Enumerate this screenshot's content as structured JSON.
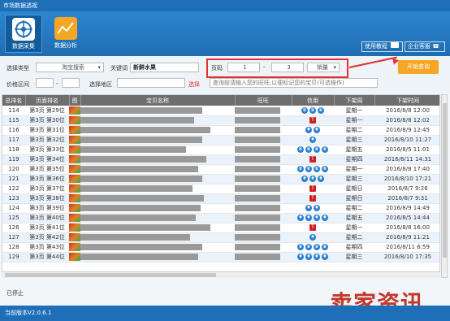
{
  "window": {
    "title": "市场数据透视"
  },
  "toolbar": {
    "tools": [
      {
        "label": "数据采集",
        "icon": "target-icon",
        "active": true
      },
      {
        "label": "数据分析",
        "icon": "chart-icon",
        "active": false
      }
    ],
    "tutorial_label": "使用教程",
    "support_label": "企业客服"
  },
  "filters": {
    "select_type_label": "选择类型",
    "select_type_value": "淘宝搜索",
    "keyword_label": "关键词",
    "keyword_value": "新鲜水果",
    "page_label": "页码",
    "page_from": "1",
    "page_sep": "-",
    "page_to": "3",
    "sort_value": "销量",
    "price_label": "价格区间",
    "price_sep": "-",
    "region_label": "选择地区",
    "region_action": "选择",
    "shop_placeholder": "查询前请输入您的旺旺,以便标记您的宝贝(可选操作)",
    "start_button": "开始查询",
    "accent_color": "#f5a623",
    "highlight_color": "#e03030"
  },
  "table": {
    "columns": [
      "总排名",
      "页面排名",
      "图",
      "宝贝名称",
      "旺旺",
      "信用",
      "下架周",
      "下架时间"
    ],
    "rows": [
      {
        "rank": "114",
        "page": "第3页 第29位",
        "credit": "crown3",
        "week": "星期一",
        "time": "2016/8/8 12:00"
      },
      {
        "rank": "115",
        "page": "第3页 第30位",
        "credit": "T",
        "week": "星期一",
        "time": "2016/8/8 12:02"
      },
      {
        "rank": "116",
        "page": "第3页 第31位",
        "credit": "diamond2",
        "week": "星期二",
        "time": "2016/8/9 12:45"
      },
      {
        "rank": "117",
        "page": "第3页 第32位",
        "credit": "diamond1",
        "week": "星期三",
        "time": "2016/8/10 11:27"
      },
      {
        "rank": "118",
        "page": "第3页 第33位",
        "credit": "crown4",
        "week": "星期五",
        "time": "2016/8/5 11:01"
      },
      {
        "rank": "119",
        "page": "第3页 第34位",
        "credit": "T",
        "week": "星期四",
        "time": "2016/8/11 14:31"
      },
      {
        "rank": "120",
        "page": "第3页 第35位",
        "credit": "crown4",
        "week": "星期一",
        "time": "2016/8/8 17:40"
      },
      {
        "rank": "121",
        "page": "第3页 第36位",
        "credit": "diamond3",
        "week": "星期三",
        "time": "2016/8/10 17:21"
      },
      {
        "rank": "122",
        "page": "第3页 第37位",
        "credit": "T",
        "week": "星期日",
        "time": "2016/8/7 9:26"
      },
      {
        "rank": "123",
        "page": "第3页 第38位",
        "credit": "T",
        "week": "星期日",
        "time": "2016/8/7 9:31"
      },
      {
        "rank": "124",
        "page": "第3页 第39位",
        "credit": "diamond2",
        "week": "星期二",
        "time": "2016/8/9 14:49"
      },
      {
        "rank": "125",
        "page": "第3页 第40位",
        "credit": "diamond4",
        "week": "星期五",
        "time": "2016/8/5 14:44"
      },
      {
        "rank": "126",
        "page": "第3页 第41位",
        "credit": "T",
        "week": "星期一",
        "time": "2016/8/8 16:00"
      },
      {
        "rank": "127",
        "page": "第3页 第42位",
        "credit": "diamond1",
        "week": "星期二",
        "time": "2016/8/9 11:21"
      },
      {
        "rank": "128",
        "page": "第3页 第43位",
        "credit": "crown4",
        "week": "星期四",
        "time": "2016/8/11 6:59"
      },
      {
        "rank": "129",
        "page": "第3页 第44位",
        "credit": "diamond4",
        "week": "星期三",
        "time": "2016/8/10 17:35"
      }
    ]
  },
  "status": {
    "state": "已停止",
    "version": "当前版本V2.0.6.1"
  },
  "watermark": {
    "text": "卖家资讯"
  }
}
